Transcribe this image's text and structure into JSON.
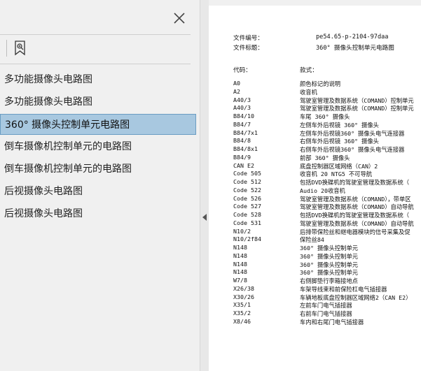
{
  "sidebar": {
    "bookmarks": [
      {
        "label": "多功能摄像头电路图",
        "selected": false
      },
      {
        "label": "多功能摄像头电路图",
        "selected": false
      },
      {
        "label": "360° 摄像头控制单元电路图",
        "selected": true
      },
      {
        "label": "倒车摄像机控制单元的电路图",
        "selected": false
      },
      {
        "label": "倒车摄像机控制单元的电路图",
        "selected": false
      },
      {
        "label": "后视摄像头电路图",
        "selected": false
      },
      {
        "label": "后视摄像头电路图",
        "selected": false
      }
    ],
    "icons": {
      "close": "close-icon",
      "bookmark_tool": "bookmark-search-icon",
      "collapse": "collapse-arrow-icon"
    }
  },
  "document": {
    "file_no_label": "文件编号：",
    "file_no_value": "pe54.65-p-2104-97daa",
    "file_title_label": "文件标题：",
    "file_title_value": "360° 摄像头控制单元电路图",
    "col_code": "代码：",
    "col_desc": "款式：",
    "rows": [
      {
        "code": "A0",
        "desc": "颜色标记的说明"
      },
      {
        "code": "A2",
        "desc": "收音机"
      },
      {
        "code": "A40/3",
        "desc": "驾驶室管理及数据系统（COMAND）控制单元"
      },
      {
        "code": "A40/3",
        "desc": "驾驶室管理及数据系统（COMAND）控制单元"
      },
      {
        "code": "B84/10",
        "desc": "车尾 360° 摄像头"
      },
      {
        "code": "B84/7",
        "desc": "左侧车外后视镜 360° 摄像头"
      },
      {
        "code": "B84/7x1",
        "desc": "左侧车外后视镜360° 摄像头电气连接器"
      },
      {
        "code": "B84/8",
        "desc": "右侧车外后视镜 360° 摄像头"
      },
      {
        "code": "B84/8x1",
        "desc": "右侧车外后视镜360° 摄像头电气连接器"
      },
      {
        "code": "B84/9",
        "desc": "前部 360° 摄像头"
      },
      {
        "code": "CAN E2",
        "desc": "底盘控制器区域网络（CAN）2"
      },
      {
        "code": "Code 505",
        "desc": "收音机 20 NTG5 不可导航"
      },
      {
        "code": "Code 512",
        "desc": "包括DVD换碟机的驾驶室管理及数据系统（"
      },
      {
        "code": "Code 522",
        "desc": "Audio 20收音机"
      },
      {
        "code": "Code 526",
        "desc": "驾驶室管理及数据系统（COMAND），带单区"
      },
      {
        "code": "Code 527",
        "desc": "驾驶室管理及数据系统（COMAND）自动导航"
      },
      {
        "code": "Code 528",
        "desc": "包括DVD换碟机的驾驶室管理及数据系统（"
      },
      {
        "code": "Code 531",
        "desc": "驾驶室管理及数据系统（COMAND）自动导航"
      },
      {
        "code": "N10/2",
        "desc": "后排带保险丝和继电器模块的信号采集及促"
      },
      {
        "code": "N10/2f84",
        "desc": "保险丝84"
      },
      {
        "code": "N148",
        "desc": "360° 摄像头控制单元"
      },
      {
        "code": "N148",
        "desc": "360° 摄像头控制单元"
      },
      {
        "code": "N148",
        "desc": "360° 摄像头控制单元"
      },
      {
        "code": "N148",
        "desc": "360° 摄像头控制单元"
      },
      {
        "code": "W7/8",
        "desc": "右侧脚垫行李箱接地点"
      },
      {
        "code": "X26/38",
        "desc": "车架导线束和前保险杠电气插接器"
      },
      {
        "code": "X30/26",
        "desc": "车辆地板底盘控制器区域网络2（CAN E2）"
      },
      {
        "code": "X35/1",
        "desc": "左前车门电气插接器"
      },
      {
        "code": "X35/2",
        "desc": "右前车门电气插接器"
      },
      {
        "code": "X8/46",
        "desc": "车内和右尾门电气插接器"
      }
    ]
  },
  "colors": {
    "selection_bg": "#a8c8e0",
    "selection_border": "#6a9cc2",
    "panel_bg": "#f0f0f0",
    "page_bg": "#ffffff"
  }
}
